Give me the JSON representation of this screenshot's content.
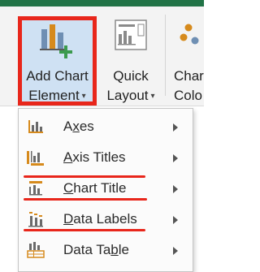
{
  "ribbon": {
    "add_chart_element": {
      "line1": "Add Chart",
      "line2": "Element",
      "caret": "▾",
      "highlighted": true,
      "highlight_color": "#e8261b"
    },
    "quick_layout": {
      "line1": "Quick",
      "line2": "Layout",
      "caret": "▾"
    },
    "change_colors": {
      "line1": "Char",
      "line2": "Colo"
    }
  },
  "menu": {
    "items": [
      {
        "label": "Axes",
        "mnemonic": "x",
        "icon": "axes-icon"
      },
      {
        "label": "Axis Titles",
        "mnemonic": "A",
        "icon": "axis-titles-icon",
        "underlined_red": true
      },
      {
        "label": "Chart Title",
        "mnemonic": "C",
        "icon": "chart-title-icon",
        "underlined_red": true
      },
      {
        "label": "Data Labels",
        "mnemonic": "D",
        "icon": "data-labels-icon",
        "underlined_red": true
      },
      {
        "label": "Data Table",
        "mnemonic": "b",
        "icon": "data-table-icon"
      }
    ]
  },
  "colors": {
    "excel_green": "#217346",
    "highlight_red": "#e8261b",
    "selected_button_bg": "#cfe1f3",
    "icon_orange": "#d68a1c"
  }
}
